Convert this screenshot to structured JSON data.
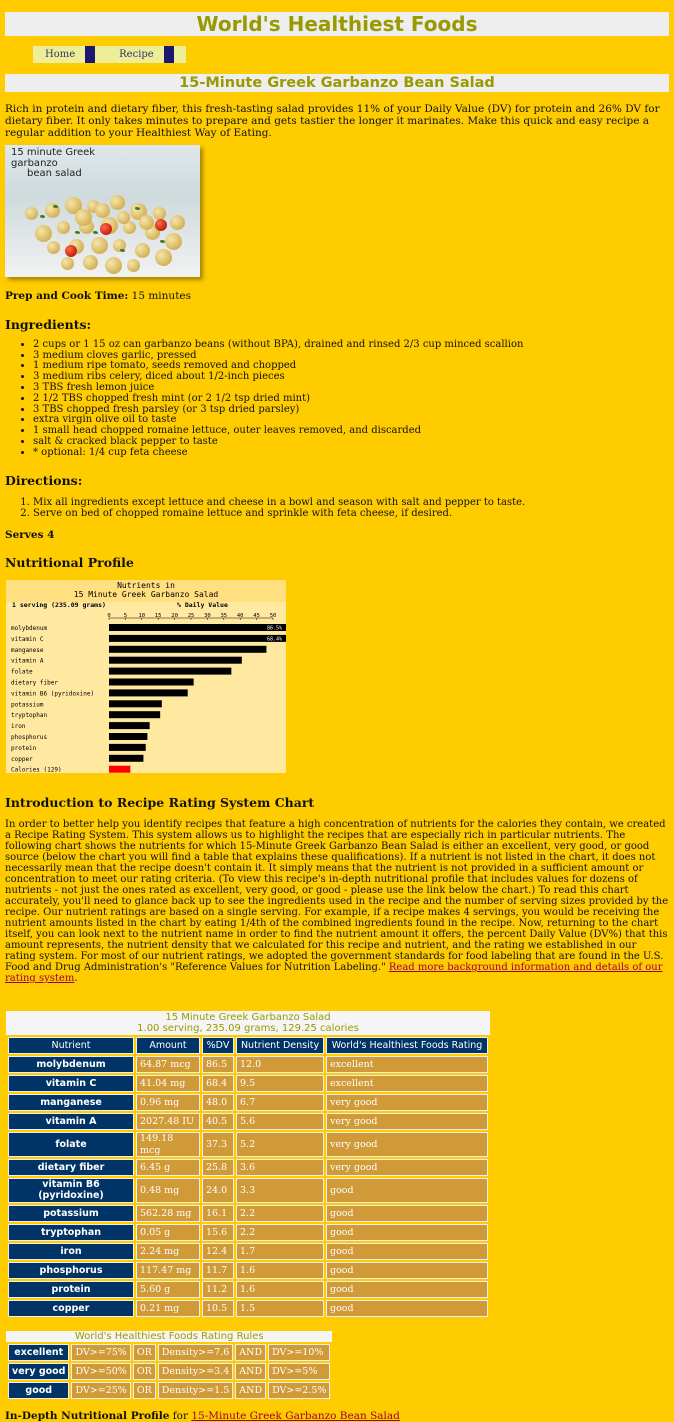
{
  "site_title": "World's Healthiest Foods",
  "nav": {
    "home": "Home",
    "recipe": "Recipe"
  },
  "recipe_title": "15-Minute Greek Garbanzo Bean Salad",
  "intro": "Rich in protein and dietary fiber, this fresh-tasting salad provides 11% of your Daily Value (DV) for protein and 26% DV for dietary fiber. It only takes minutes to prepare and gets tastier the longer it marinates. Make this quick and easy recipe a regular addition to your Healthiest Way of Eating.",
  "photo_caption_1": "15 minute Greek garbanzo",
  "photo_caption_2": "bean salad",
  "prep_label": "Prep and Cook Time:",
  "prep_value": " 15 minutes",
  "ingredients_heading": "Ingredients:",
  "ingredients": [
    "2 cups or 1 15 oz can garbanzo beans (without BPA), drained and rinsed 2/3 cup minced scallion",
    "3 medium cloves garlic, pressed",
    "1 medium ripe tomato, seeds removed and chopped",
    "3 medium ribs celery, diced about 1/2-inch pieces",
    "3 TBS fresh lemon juice",
    "2 1/2 TBS chopped fresh mint (or 2 1/2 tsp dried mint)",
    "3 TBS chopped fresh parsley (or 3 tsp dried parsley)",
    "extra virgin olive oil to taste",
    "1 small head chopped romaine lettuce, outer leaves removed, and discarded",
    "salt & cracked black pepper to taste",
    "* optional: 1/4 cup feta cheese"
  ],
  "directions_heading": "Directions:",
  "directions": [
    "Mix all ingredients except lettuce and cheese in a bowl and season with salt and pepper to taste.",
    "Serve on bed of chopped romaine lettuce and sprinkle with feta cheese, if desired."
  ],
  "serves": "Serves 4",
  "nutritional_profile_heading": "Nutritional Profile",
  "chart_data": {
    "type": "bar",
    "title": "Nutrients in",
    "subtitle": "15 Minute Greek Garbanzo Salad",
    "serving_label": "1 serving (235.09 grams)",
    "xlabel": "% Daily Value",
    "xlim": [
      0,
      50
    ],
    "ticks": [
      0,
      5,
      10,
      15,
      20,
      25,
      30,
      35,
      40,
      45,
      50
    ],
    "categories": [
      "molybdenum",
      "vitamin C",
      "manganese",
      "vitamin A",
      "folate",
      "dietary fiber",
      "vitamin B6 (pyridoxine)",
      "potassium",
      "tryptophan",
      "iron",
      "phosphorus",
      "protein",
      "copper",
      "Calories (129)"
    ],
    "values": [
      86.5,
      68.4,
      48.0,
      40.5,
      37.3,
      25.8,
      24.0,
      16.1,
      15.6,
      12.4,
      11.7,
      11.2,
      10.5,
      6.5
    ],
    "value_labels": [
      "86.5%",
      "68.4%",
      "",
      "",
      "",
      "",
      "",
      "",
      "",
      "",
      "",
      "",
      "",
      ""
    ],
    "colors": {
      "bar": "#000000",
      "calories": "#ff0000"
    }
  },
  "rating_intro_heading": "Introduction to Recipe Rating System Chart",
  "rating_intro_text": "In order to better help you identify recipes that feature a high concentration of nutrients for the calories they contain, we created a Recipe Rating System. This system allows us to highlight the recipes that are especially rich in particular nutrients. The following chart shows the nutrients for which 15-Minute Greek Garbanzo Bean Salad is either an excellent, very good, or good source (below the chart you will find a table that explains these qualifications). If a nutrient is not listed in the chart, it does not necessarily mean that the recipe doesn't contain it. It simply means that the nutrient is not provided in a sufficient amount or concentration to meet our rating criteria. (To view this recipe's in-depth nutritional profile that includes values for dozens of nutrients - not just the ones rated as excellent, very good, or good - please use the link below the chart.) To read this chart accurately, you'll need to glance back up to see the ingredients used in the recipe and the number of serving sizes provided by the recipe. Our nutrient ratings are based on a single serving. For example, if a recipe makes 4 servings, you would be receiving the nutrient amounts listed in the chart by eating 1/4th of the combined ingredients found in the recipe. Now, returning to the chart itself, you can look next to the nutrient name in order to find the nutrient amount it offers, the percent Daily Value (DV%) that this amount represents, the nutrient density that we calculated for this recipe and nutrient, and the rating we established in our rating system. For most of our nutrient ratings, we adopted the government standards for food labeling that are found in the U.S. Food and Drug Administration's \"Reference Values for Nutrition Labeling.\" ",
  "rating_intro_link": "Read more background information and details of our rating system",
  "rating_intro_end": ".",
  "table": {
    "caption_1": "15 Minute Greek Garbanzo Salad",
    "caption_2": "1.00 serving, 235.09 grams, 129.25 calories",
    "headers": [
      "Nutrient",
      "Amount",
      "%DV",
      "Nutrient Density",
      "World's Healthiest Foods Rating"
    ],
    "rows": [
      [
        "molybdenum",
        "64.87 mcg",
        "86.5",
        "12.0",
        "excellent"
      ],
      [
        "vitamin C",
        "41.04 mg",
        "68.4",
        "9.5",
        "excellent"
      ],
      [
        "manganese",
        "0.96 mg",
        "48.0",
        "6.7",
        "very good"
      ],
      [
        "vitamin A",
        "2027.48 IU",
        "40.5",
        "5.6",
        "very good"
      ],
      [
        "folate",
        "149.18 mcg",
        "37.3",
        "5.2",
        "very good"
      ],
      [
        "dietary fiber",
        "6.45 g",
        "25.8",
        "3.6",
        "very good"
      ],
      [
        "vitamin B6 (pyridoxine)",
        "0.48 mg",
        "24.0",
        "3.3",
        "good"
      ],
      [
        "potassium",
        "562.28 mg",
        "16.1",
        "2.2",
        "good"
      ],
      [
        "tryptophan",
        "0.05 g",
        "15.6",
        "2.2",
        "good"
      ],
      [
        "iron",
        "2.24 mg",
        "12.4",
        "1.7",
        "good"
      ],
      [
        "phosphorus",
        "117.47 mg",
        "11.7",
        "1.6",
        "good"
      ],
      [
        "protein",
        "5.60 g",
        "11.2",
        "1.6",
        "good"
      ],
      [
        "copper",
        "0.21 mg",
        "10.5",
        "1.5",
        "good"
      ]
    ]
  },
  "rules": {
    "caption": "World's Healthiest Foods Rating Rules",
    "rows": [
      [
        "excellent",
        "DV>=75%",
        "OR",
        "Density>=7.6",
        "AND",
        "DV>=10%"
      ],
      [
        "very good",
        "DV>=50%",
        "OR",
        "Density>=3.4",
        "AND",
        "DV>=5%"
      ],
      [
        "good",
        "DV>=25%",
        "OR",
        "Density>=1.5",
        "AND",
        "DV>=2.5%"
      ]
    ]
  },
  "indepth_label": "In-Depth Nutritional Profile",
  "indepth_for": " for ",
  "indepth_link": "15-Minute Greek Garbanzo Bean Salad"
}
